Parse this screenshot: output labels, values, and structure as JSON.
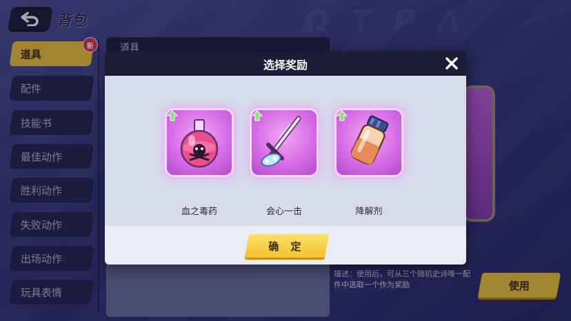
{
  "header": {
    "title": "背包"
  },
  "sidebar": {
    "items": [
      {
        "label": "道具",
        "active": true,
        "badge": "新"
      },
      {
        "label": "配件"
      },
      {
        "label": "技能书"
      },
      {
        "label": "最佳动作"
      },
      {
        "label": "胜利动作"
      },
      {
        "label": "失败动作"
      },
      {
        "label": "出场动作"
      },
      {
        "label": "玩具表情"
      }
    ]
  },
  "items_panel": {
    "title": "道具"
  },
  "detail": {
    "description": "描述：使用后，可从三个随机史诗唯一配件中选取一个作为奖励",
    "use_label": "使用"
  },
  "modal": {
    "title": "选择奖励",
    "rewards": [
      {
        "name": "血之毒药",
        "icon": "poison-flask-icon",
        "checked": true
      },
      {
        "name": "会心一击",
        "icon": "sword-icon",
        "checked": false
      },
      {
        "name": "降解剂",
        "icon": "medicine-bottle-icon",
        "checked": false
      }
    ],
    "confirm_label": "确 定"
  },
  "colors": {
    "accent_yellow": "#f4c83a",
    "modal_header": "#1b1c36",
    "reward_glow": "#d86ee6",
    "check_green": "#39c24a",
    "badge_red": "#e8344c"
  }
}
